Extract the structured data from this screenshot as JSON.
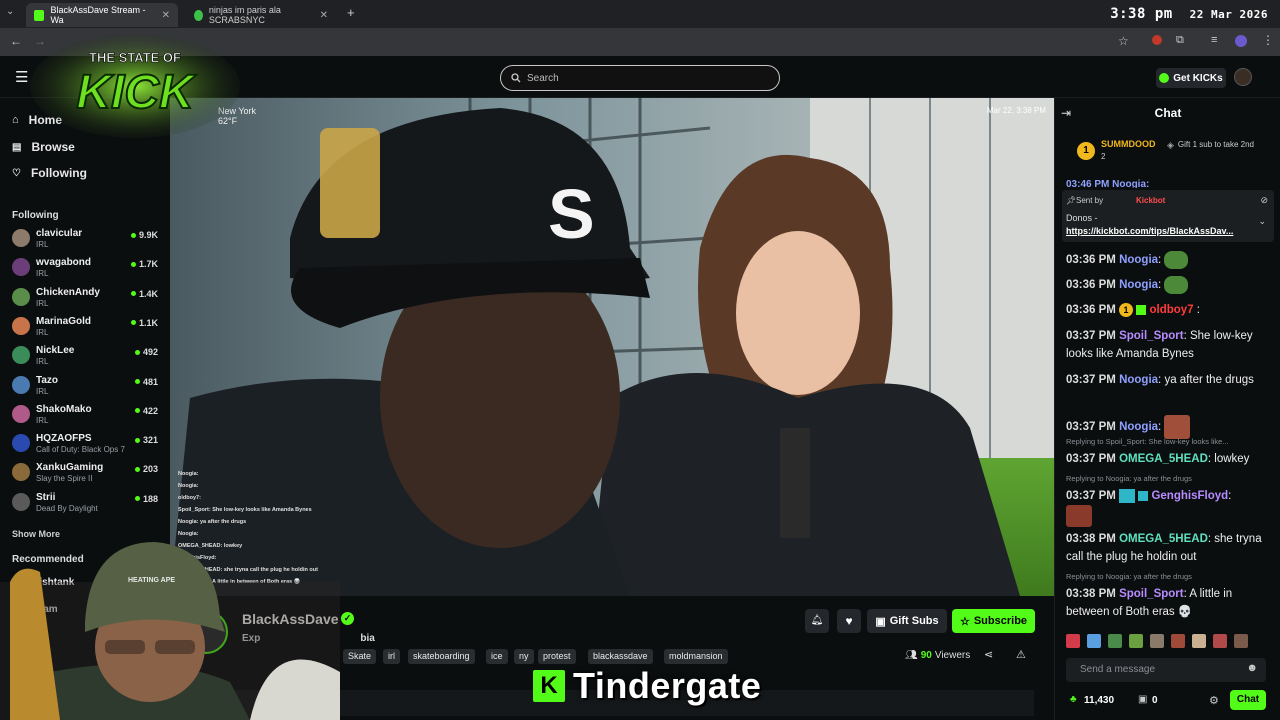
{
  "browser": {
    "tabs": [
      {
        "title": "BlackAssDave Stream - Wa",
        "active": true
      },
      {
        "title": "ninjas im paris ala SCRABSNYC",
        "active": false
      }
    ],
    "clock_time": "3:38 pm",
    "clock_date": "22 Mar 2026"
  },
  "overlay_logo": {
    "line1": "THE STATE OF",
    "line2": "KICK"
  },
  "header": {
    "search_placeholder": "Search",
    "get_kicks_label": "Get KICKs"
  },
  "sidebar": {
    "nav": [
      {
        "label": "Home",
        "icon": "home-icon"
      },
      {
        "label": "Browse",
        "icon": "browse-icon"
      },
      {
        "label": "Following",
        "icon": "heart-icon"
      }
    ],
    "following_title": "Following",
    "following": [
      {
        "name": "clavicular",
        "category": "IRL",
        "viewers": "9.9K",
        "color": "#8c7a6a"
      },
      {
        "name": "wvagabond",
        "category": "IRL",
        "viewers": "1.7K",
        "color": "#6b3e7a"
      },
      {
        "name": "ChickenAndy",
        "category": "IRL",
        "viewers": "1.4K",
        "color": "#5a8c4a"
      },
      {
        "name": "MarinaGold",
        "category": "IRL",
        "viewers": "1.1K",
        "color": "#c8744a"
      },
      {
        "name": "NickLee",
        "category": "IRL",
        "viewers": "492",
        "color": "#3a8c5a"
      },
      {
        "name": "Tazo",
        "category": "IRL",
        "viewers": "481",
        "color": "#4a7ab0"
      },
      {
        "name": "ShakoMako",
        "category": "IRL",
        "viewers": "422",
        "color": "#b05a8a"
      },
      {
        "name": "HQZAOFPS",
        "category": "Call of Duty: Black Ops 7",
        "viewers": "321",
        "color": "#2a4ab0"
      },
      {
        "name": "XankuGaming",
        "category": "Slay the Spire II",
        "viewers": "203",
        "color": "#8a6a3a"
      },
      {
        "name": "Strii",
        "category": "Dead By Daylight",
        "viewers": "188",
        "color": "#5a5a5a"
      }
    ],
    "show_more": "Show More",
    "recommended_title": "Recommended",
    "recommended": [
      {
        "name": "fishtank"
      },
      {
        "name": "Dam"
      }
    ]
  },
  "video": {
    "location": "New York",
    "temp": "62°F",
    "timestamp": "Mar 22, 3:38 PM",
    "cap_letter": "S",
    "chat_overlay": [
      "Noogia:",
      "Noogia:",
      "oldboy7:",
      "Spoil_Sport: She low-key looks like Amanda Bynes",
      "Noogia: ya after the drugs",
      "Noogia:",
      "OMEGA_5HEAD: lowkey",
      "GenghisFloyd:",
      "OMEGA_5HEAD: she tryna call the plug he holdin out",
      "Spoil_Sport: A little in between of Both eras 💀"
    ]
  },
  "stream": {
    "channel": "BlackAssDave",
    "title": "Exp",
    "title_suffix": "bia",
    "tags": [
      "Skate",
      "irl",
      "skateboarding",
      "ice",
      "ny",
      "protest",
      "blackassdave",
      "moldmansion"
    ],
    "viewers": "90",
    "viewers_label": "Viewers",
    "gift_subs_label": "Gift Subs",
    "subscribe_label": "Subscribe",
    "webcam_cap_text": "HEATING APE",
    "caption": "Tindergate"
  },
  "chat": {
    "title": "Chat",
    "top_gifter": {
      "name": "SUMMDOOD",
      "count": "2",
      "rank": "1"
    },
    "gift_prompt": "Gift 1 sub to take 2nd",
    "pinned": {
      "sent_by": "Sent by",
      "bot": "Kickbot",
      "title": "Donos -",
      "link": "https://kickbot.com/tips/BlackAssDav..."
    },
    "partial_line": "03:46 PM Noogia:",
    "messages": [
      {
        "time": "03:36 PM",
        "user": "Noogia",
        "color": "#8fa0ff",
        "text": "",
        "emote": "pepe"
      },
      {
        "time": "03:36 PM",
        "user": "Noogia",
        "color": "#8fa0ff",
        "text": "",
        "emote": "pepe"
      },
      {
        "time": "03:36 PM",
        "user": "oldboy7",
        "color": "#ff3b3b",
        "text": ":",
        "badge": "1"
      },
      {
        "time": "03:37 PM",
        "user": "Spoil_Sport",
        "color": "#b68cff",
        "text": "She low-key looks like Amanda Bynes"
      },
      {
        "time": "03:37 PM",
        "user": "Noogia",
        "color": "#8fa0ff",
        "text": "ya after the drugs"
      },
      {
        "time": "03:37 PM",
        "user": "Noogia",
        "color": "#8fa0ff",
        "text": "",
        "emote": "face"
      },
      {
        "reply": "Replying to Spoil_Sport: She low-key looks like...",
        "time": "03:37 PM",
        "user": "OMEGA_5HEAD",
        "color": "#5fe0c0",
        "text": "lowkey"
      },
      {
        "reply": "Replying to Noogia: ya after the drugs",
        "time": "03:37 PM",
        "user": "GenghisFloyd",
        "color": "#b68cff",
        "text": ""
      },
      {
        "time": "03:38 PM",
        "user": "OMEGA_5HEAD",
        "color": "#5fe0c0",
        "text": "she tryna call the plug he holdin out"
      },
      {
        "reply": "Replying to Noogia: ya after the drugs",
        "time": "03:38 PM",
        "user": "Spoil_Sport",
        "color": "#b68cff",
        "text": "A little in between of Both eras 💀"
      }
    ],
    "input_placeholder": "Send a message",
    "points": "11,430",
    "count": "0",
    "send_label": "Chat"
  },
  "colors": {
    "kick_green": "#53fc18",
    "bg": "#0b0e0f"
  }
}
